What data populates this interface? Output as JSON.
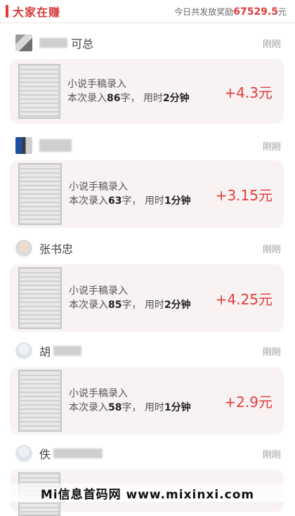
{
  "header": {
    "title": "大家在赚",
    "stats_label": "今日共发放奖励",
    "stats_amount": "67529.5",
    "stats_unit": "元"
  },
  "items": [
    {
      "username": "可总",
      "time": "刚刚",
      "task": "小说手稿录入",
      "detail_prefix": "本次录入",
      "count": "86",
      "count_unit": "字",
      "time_prefix": "用时",
      "duration": "2分钟",
      "reward": "+4.3元"
    },
    {
      "username": "",
      "time": "刚刚",
      "task": "小说手稿录入",
      "detail_prefix": "本次录入",
      "count": "63",
      "count_unit": "字",
      "time_prefix": "用时",
      "duration": "1分钟",
      "reward": "+3.15元"
    },
    {
      "username": "张书忠",
      "time": "刚刚",
      "task": "小说手稿录入",
      "detail_prefix": "本次录入",
      "count": "85",
      "count_unit": "字",
      "time_prefix": "用时",
      "duration": "2分钟",
      "reward": "+4.25元"
    },
    {
      "username": "胡",
      "time": "刚刚",
      "task": "小说手稿录入",
      "detail_prefix": "本次录入",
      "count": "58",
      "count_unit": "字",
      "time_prefix": "用时",
      "duration": "1分钟",
      "reward": "+2.9元"
    },
    {
      "username": "佚",
      "time": "刚刚"
    }
  ],
  "watermark": "Mi信息首码网 www.mixinxi.com",
  "colors": {
    "accent": "#e23c3c",
    "card_bg": "#f8f2f2"
  }
}
